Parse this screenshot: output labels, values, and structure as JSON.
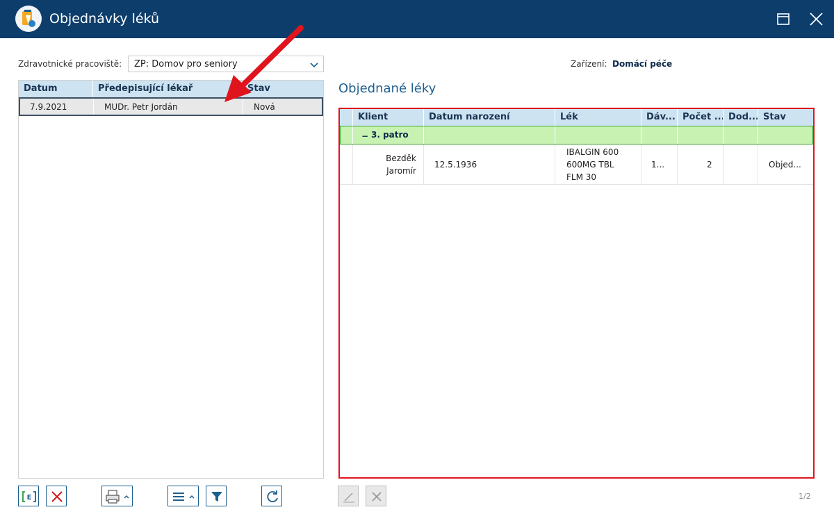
{
  "window": {
    "title": "Objednávky léků"
  },
  "filters": {
    "workplace_label": "Zdravotnické pracoviště:",
    "workplace_value": "ZP: Domov pro seniory",
    "device_label": "Zařízení:",
    "device_value": "Domácí péče"
  },
  "orders_table": {
    "columns": [
      "Datum",
      "Předepisující lékař",
      "Stav"
    ],
    "rows": [
      {
        "datum": "7.9.2021",
        "lekar": "MUDr. Petr Jordán",
        "stav": "Nová"
      }
    ]
  },
  "ordered_meds": {
    "section_title": "Objednané léky",
    "columns": [
      "Klient",
      "Datum narození",
      "Lék",
      "Dáv...",
      "Počet ...",
      "Dod...",
      "Stav"
    ],
    "group": {
      "toggle": "−",
      "label": "3. patro"
    },
    "rows": [
      {
        "klient_line1": "Bezděk",
        "klient_line2": "Jaromír",
        "datum_narozeni": "12.5.1936",
        "lek_line1": "IBALGIN 600",
        "lek_line2": "600MG TBL",
        "lek_line3": "FLM 30",
        "davka": "1...",
        "pocet": "2",
        "dodano": "",
        "stav": "Objed..."
      }
    ]
  },
  "toolbar": {
    "new_icon": "new-order-icon",
    "delete_icon": "delete-icon",
    "print_icon": "print-icon",
    "menu_icon": "menu-icon",
    "filter_icon": "filter-icon",
    "refresh_icon": "refresh-icon",
    "edit_icon": "edit-icon",
    "remove_icon": "remove-icon"
  },
  "pager": "1/2",
  "colors": {
    "titlebar": "#0c3d6b",
    "header": "#cde3f2",
    "group_row": "#c7f2b2",
    "highlight": "#e0141c",
    "accent": "#1d5f8e"
  }
}
